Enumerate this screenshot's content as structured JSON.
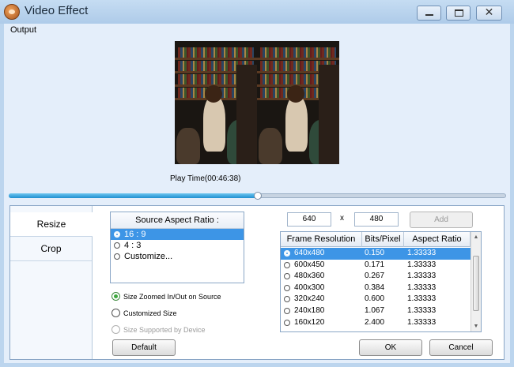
{
  "window": {
    "title": "Video Effect",
    "close_glyph": "✕"
  },
  "output": {
    "label": "Output",
    "play_time": "Play Time(00:46:38)",
    "progress": 0.5
  },
  "tabs": [
    {
      "label": "Resize"
    },
    {
      "label": "Crop"
    }
  ],
  "source_aspect": {
    "header": "Source Aspect Ratio :",
    "options": [
      {
        "label": "16 : 9"
      },
      {
        "label": "4 : 3"
      },
      {
        "label": "Customize..."
      }
    ],
    "selected": "16 : 9"
  },
  "size_options": [
    {
      "label": "Size Zoomed In/Out on Source",
      "checked": true,
      "enabled": true
    },
    {
      "label": "Customized Size",
      "checked": false,
      "enabled": true
    },
    {
      "label": "Size Supported by Device",
      "checked": false,
      "enabled": false
    }
  ],
  "resolution": {
    "width": "640",
    "height": "480",
    "times": "x",
    "add_label": "Add"
  },
  "grid": {
    "columns": [
      "Frame Resolution",
      "Bits/Pixel",
      "Aspect Ratio"
    ],
    "rows": [
      {
        "res": "640x480",
        "bits": "0.150",
        "ratio": "1.33333"
      },
      {
        "res": "600x450",
        "bits": "0.171",
        "ratio": "1.33333"
      },
      {
        "res": "480x360",
        "bits": "0.267",
        "ratio": "1.33333"
      },
      {
        "res": "400x300",
        "bits": "0.384",
        "ratio": "1.33333"
      },
      {
        "res": "320x240",
        "bits": "0.600",
        "ratio": "1.33333"
      },
      {
        "res": "240x180",
        "bits": "1.067",
        "ratio": "1.33333"
      },
      {
        "res": "160x120",
        "bits": "2.400",
        "ratio": "1.33333"
      }
    ],
    "selected": "640x480",
    "scroll_up": "▲",
    "scroll_down": "▼"
  },
  "buttons": {
    "default": "Default",
    "ok": "OK",
    "cancel": "Cancel"
  },
  "colors": {
    "accent": "#3d95e6",
    "slider": "#1f8fd0",
    "title_bar": "#bcd5ee"
  },
  "icons": [
    "app-icon",
    "minimize-icon",
    "maximize-icon",
    "close-icon",
    "scroll-up-icon",
    "scroll-down-icon"
  ]
}
